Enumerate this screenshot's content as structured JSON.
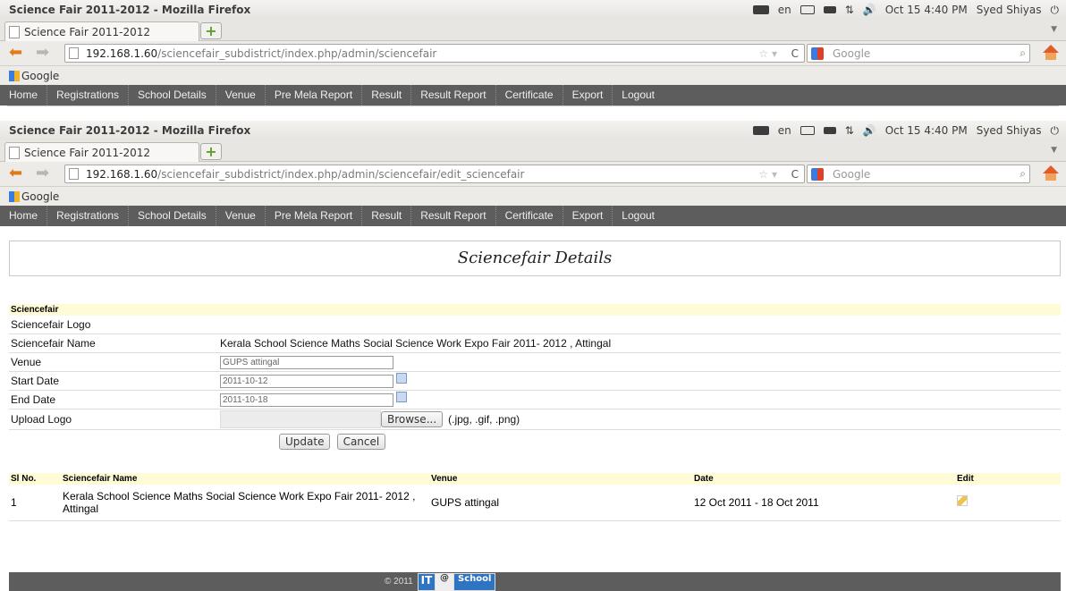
{
  "window_title": "Science Fair 2011-2012 - Mozilla Firefox",
  "system": {
    "lang": "en",
    "datetime": "Oct 15  4:40 PM",
    "user": "Syed Shiyas"
  },
  "tab_title": "Science Fair 2011-2012",
  "url1": {
    "host": "192.168.1.60",
    "path": "/sciencefair_subdistrict/index.php/admin/sciencefair"
  },
  "url2": {
    "host": "192.168.1.60",
    "path": "/sciencefair_subdistrict/index.php/admin/sciencefair/edit_sciencefair"
  },
  "search_placeholder": "Google",
  "bookmark": "Google",
  "menu": [
    "Home",
    "Registrations",
    "School Details",
    "Venue",
    "Pre Mela Report",
    "Result",
    "Result Report",
    "Certificate",
    "Export",
    "Logout"
  ],
  "page_heading": "Sciencefair Details",
  "form": {
    "section": "Sciencefair",
    "logo_label": "Sciencefair Logo",
    "name_label": "Sciencefair Name",
    "name_value": "Kerala School Science Maths Social Science Work Expo Fair 2011- 2012 , Attingal",
    "venue_label": "Venue",
    "venue_value": "GUPS attingal",
    "start_label": "Start Date",
    "start_value": "2011-10-12",
    "end_label": "End Date",
    "end_value": "2011-10-18",
    "upload_label": "Upload Logo",
    "browse": "Browse...",
    "ext": "(.jpg, .gif, .png)",
    "update": "Update",
    "cancel": "Cancel"
  },
  "table": {
    "headers": [
      "Sl No.",
      "Sciencefair Name",
      "Venue",
      "Date",
      "Edit"
    ],
    "rows": [
      {
        "sl": "1",
        "name": "Kerala School Science Maths Social Science Work Expo Fair 2011- 2012 , Attingal",
        "venue": "GUPS attingal",
        "date": "12 Oct 2011  -  18 Oct 2011"
      }
    ]
  },
  "footer": {
    "text": "© 2011",
    "logo_it": "IT",
    "logo_at": "@",
    "logo_school": "School"
  }
}
